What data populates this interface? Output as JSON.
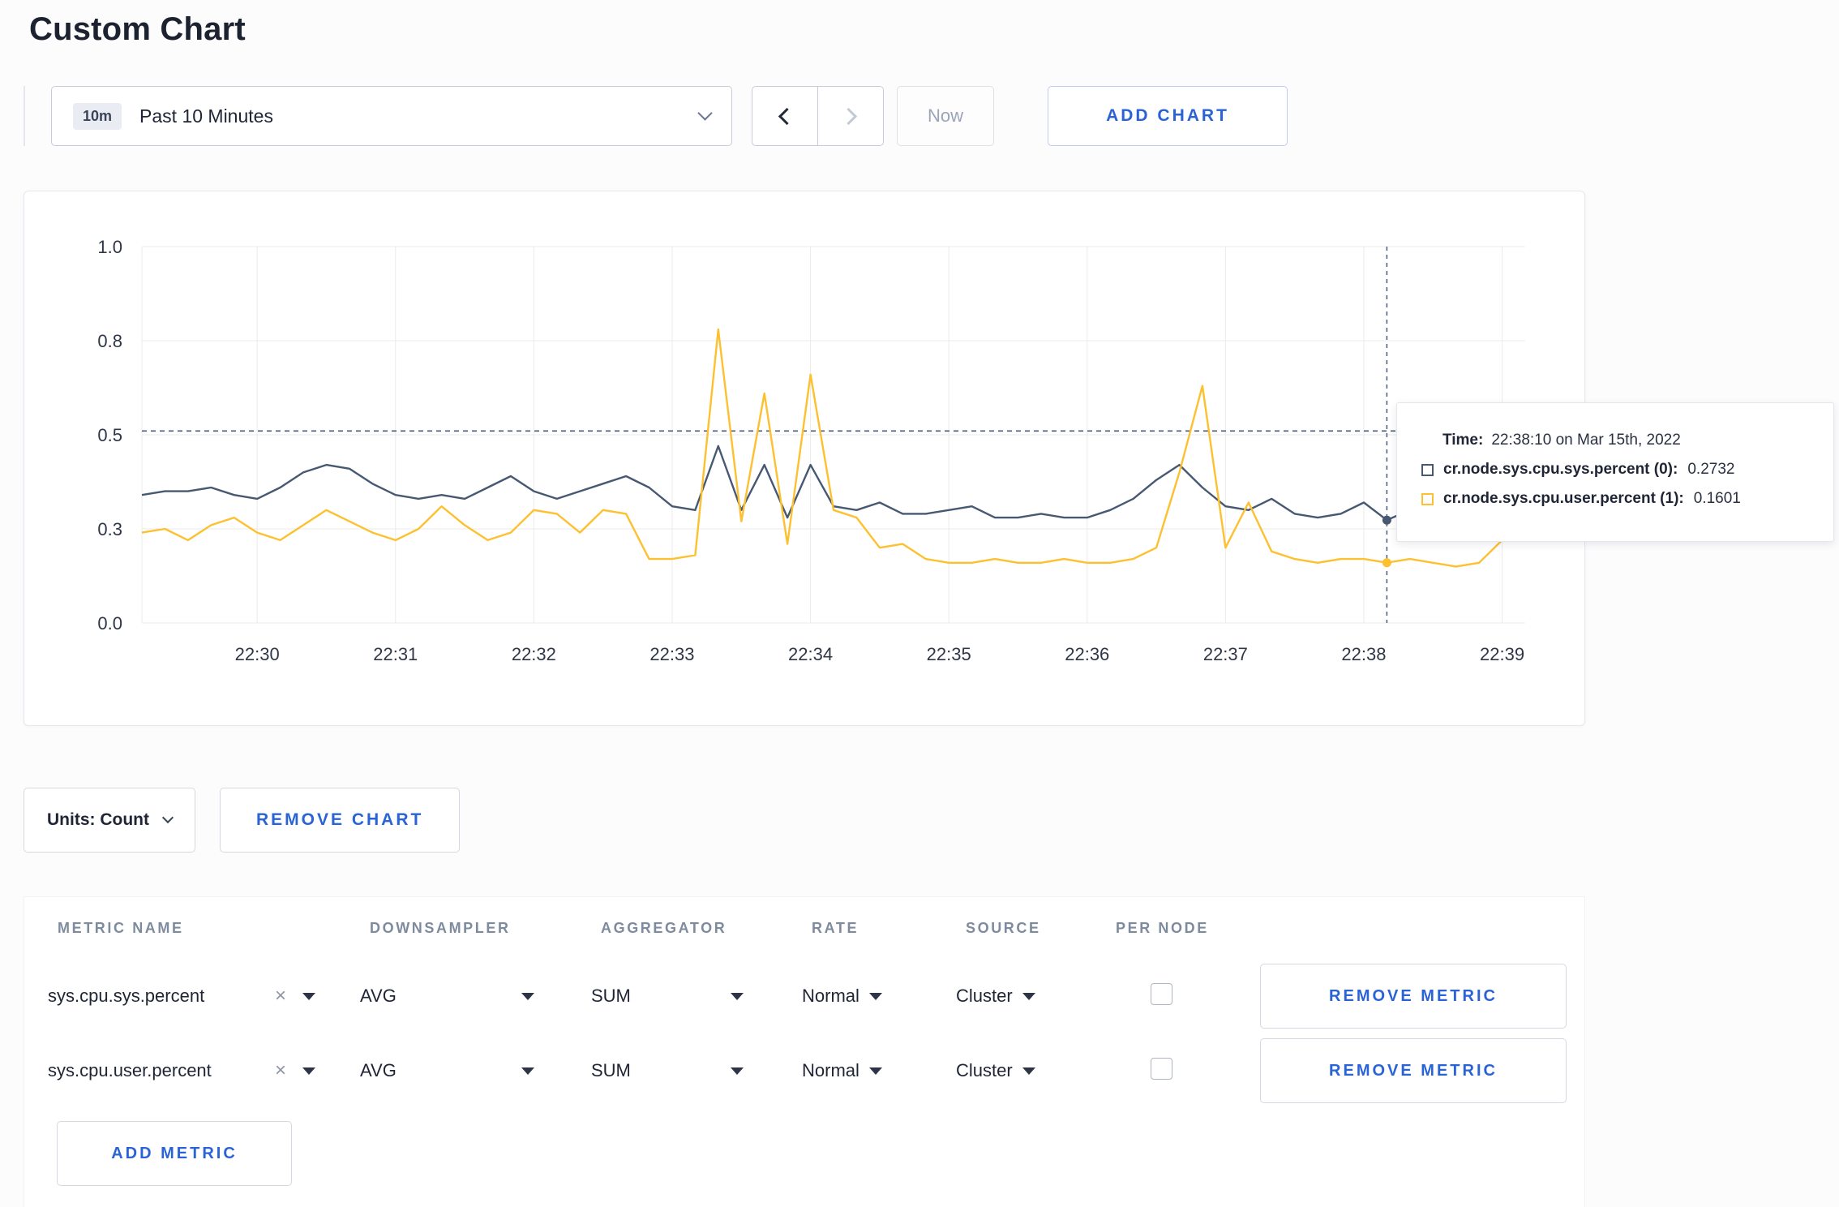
{
  "page": {
    "title": "Custom Chart"
  },
  "toolbar": {
    "time_range": {
      "badge": "10m",
      "label": "Past 10 Minutes"
    },
    "prev_icon": "chevron-left-icon",
    "next_icon": "chevron-right-icon",
    "now_label": "Now",
    "add_chart_label": "ADD CHART"
  },
  "chart_data": {
    "type": "line",
    "title": "",
    "xlabel": "",
    "ylabel": "",
    "ylim": [
      0,
      1
    ],
    "grid": true,
    "n_points": 61,
    "x_tick_indices": [
      5,
      11,
      17,
      23,
      29,
      35,
      41,
      47,
      53,
      59
    ],
    "x_tick_labels": [
      "22:30",
      "22:31",
      "22:32",
      "22:33",
      "22:34",
      "22:35",
      "22:36",
      "22:37",
      "22:38",
      "22:39"
    ],
    "y_ticks": [
      {
        "label": "0.0",
        "value": 0.0
      },
      {
        "label": "0.3",
        "value": 0.25
      },
      {
        "label": "0.5",
        "value": 0.5
      },
      {
        "label": "0.8",
        "value": 0.75
      },
      {
        "label": "1.0",
        "value": 1.0
      }
    ],
    "series": [
      {
        "name": "cr.node.sys.cpu.sys.percent",
        "color": "#475872",
        "values": [
          0.34,
          0.35,
          0.35,
          0.36,
          0.34,
          0.33,
          0.36,
          0.4,
          0.42,
          0.41,
          0.37,
          0.34,
          0.33,
          0.34,
          0.33,
          0.36,
          0.39,
          0.35,
          0.33,
          0.35,
          0.37,
          0.39,
          0.36,
          0.31,
          0.3,
          0.47,
          0.3,
          0.42,
          0.28,
          0.42,
          0.31,
          0.3,
          0.32,
          0.29,
          0.29,
          0.3,
          0.31,
          0.28,
          0.28,
          0.29,
          0.28,
          0.28,
          0.3,
          0.33,
          0.38,
          0.42,
          0.36,
          0.31,
          0.3,
          0.33,
          0.29,
          0.28,
          0.29,
          0.32,
          0.2732,
          0.3,
          0.29,
          0.3,
          0.29,
          0.3,
          0.3
        ]
      },
      {
        "name": "cr.node.sys.cpu.user.percent",
        "color": "#fdc02f",
        "values": [
          0.24,
          0.25,
          0.22,
          0.26,
          0.28,
          0.24,
          0.22,
          0.26,
          0.3,
          0.27,
          0.24,
          0.22,
          0.25,
          0.31,
          0.26,
          0.22,
          0.24,
          0.3,
          0.29,
          0.24,
          0.3,
          0.29,
          0.17,
          0.17,
          0.18,
          0.78,
          0.27,
          0.61,
          0.21,
          0.66,
          0.3,
          0.28,
          0.2,
          0.21,
          0.17,
          0.16,
          0.16,
          0.17,
          0.16,
          0.16,
          0.17,
          0.16,
          0.16,
          0.17,
          0.2,
          0.4,
          0.63,
          0.2,
          0.32,
          0.19,
          0.17,
          0.16,
          0.17,
          0.17,
          0.1601,
          0.17,
          0.16,
          0.15,
          0.16,
          0.22,
          0.27
        ]
      }
    ],
    "crosshair": {
      "x_frac": 0.9,
      "hline_value": 0.51
    },
    "hover_points": [
      {
        "series": 0,
        "value": 0.2732
      },
      {
        "series": 1,
        "value": 0.1601
      }
    ],
    "legend_position": "tooltip"
  },
  "tooltip": {
    "time_label": "Time:",
    "time_value": "22:38:10 on Mar 15th, 2022",
    "rows": [
      {
        "name": "cr.node.sys.cpu.sys.percent (0):",
        "value": "0.2732",
        "color": "#475872"
      },
      {
        "name": "cr.node.sys.cpu.user.percent (1):",
        "value": "0.1601",
        "color": "#fdc02f"
      }
    ]
  },
  "units": {
    "label": "Units: Count",
    "remove_chart_label": "REMOVE CHART"
  },
  "metrics_table": {
    "headers": [
      "METRIC NAME",
      "DOWNSAMPLER",
      "AGGREGATOR",
      "RATE",
      "SOURCE",
      "PER NODE"
    ],
    "rows": [
      {
        "metric": "sys.cpu.sys.percent",
        "downsampler": "AVG",
        "aggregator": "SUM",
        "rate": "Normal",
        "source": "Cluster",
        "per_node": false,
        "remove_label": "REMOVE METRIC"
      },
      {
        "metric": "sys.cpu.user.percent",
        "downsampler": "AVG",
        "aggregator": "SUM",
        "rate": "Normal",
        "source": "Cluster",
        "per_node": false,
        "remove_label": "REMOVE METRIC"
      }
    ],
    "add_metric_label": "ADD METRIC"
  },
  "icons": {
    "dropdown_chevron": "chevron-down-icon",
    "clear": "x-icon",
    "select_caret": "caret-down-icon"
  },
  "colors": {
    "accent_blue": "#2a63d5",
    "series_sys": "#475872",
    "series_user": "#fdc02f",
    "grid": "#ebebeb",
    "crosshair": "#4a5a78"
  }
}
